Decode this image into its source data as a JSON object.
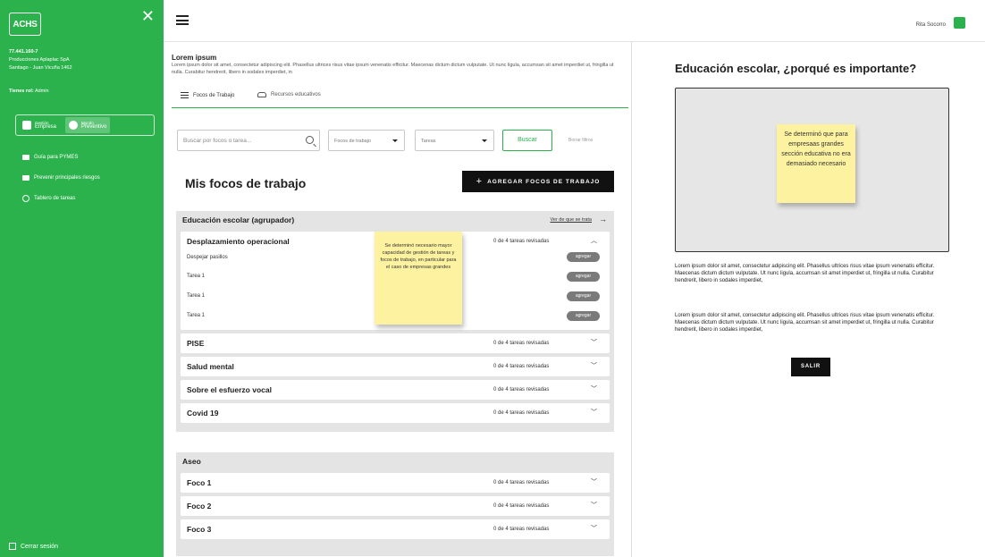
{
  "sidebar": {
    "logo": "ACHS",
    "company_lines": [
      "77.441.160-7",
      "Producciones Aplaplac SpA",
      "Santiago - Juan Vicuña 1462"
    ],
    "role_label": "Tienes rol:",
    "role_value": "Admin",
    "switch": [
      {
        "small": "Gestión",
        "label": "Empresa"
      },
      {
        "small": "Mundo",
        "label": "Preventivo"
      }
    ],
    "nav": [
      "Guía para PYMES",
      "Prevenir principales riesgos",
      "Tablero de tareas"
    ],
    "logout": "Cerrar sesión"
  },
  "header": {
    "user_name": "Rita Socorro"
  },
  "main": {
    "intro_title": "Lorem ipsum",
    "intro_text": "Lorem ipsum dolor sit amet, consectetur adipiscing elit. Phasellus ultrices risus vitae ipsum venenatis efficitur. Maecenas dictum dictum vulputate. Ut nunc ligula, accumsan sit amet imperdiet ut, fringilla ut nulla. Curabitur hendrerit, libero in sodales imperdiet, in",
    "tabs": [
      "Focos de Trabajo",
      "Recursos educativos"
    ],
    "search_placeholder": "Buscar por focos o tarea...",
    "select_focos": "Focos de trabajo",
    "select_tareas": "Tareas",
    "buscar": "Buscar",
    "borrar": "Borrar filtros",
    "section_title": "Mis focos de trabajo",
    "add_button": "AGREGAR FOCOS DE TRABAJO",
    "group1": {
      "name": "Educación escolar (agrupador)",
      "link": "Ver de que se trata",
      "expanded": {
        "title": "Desplazamiento operacional",
        "status": "0 de 4 tareas revisadas",
        "tasks": [
          "Despejar pasillos",
          "Tarea 1",
          "Tarea 1",
          "Tarea 1"
        ],
        "task_button": "agregar"
      },
      "items": [
        {
          "title": "PISE",
          "status": "0 de 4 tareas revisadas"
        },
        {
          "title": "Salud mental",
          "status": "0 de 4 tareas revisadas"
        },
        {
          "title": "Sobre el esfuerzo vocal",
          "status": "0 de 4 tareas revisadas"
        },
        {
          "title": "Covid 19",
          "status": "0 de 4 tareas revisadas"
        }
      ]
    },
    "group2": {
      "name": "Aseo",
      "items": [
        {
          "title": "Foco 1",
          "status": "0 de 4 tareas revisadas"
        },
        {
          "title": "Foco 2",
          "status": "0 de 4 tareas revisadas"
        },
        {
          "title": "Foco 3",
          "status": "0 de 4 tareas revisadas"
        }
      ]
    },
    "sticky_note": "Se determinó necesario mayor capacidad de gestión de tareas y focos de trabajo, en particular para el caso de empresas grandes"
  },
  "right_panel": {
    "title": "Educación escolar, ¿porqué es importante?",
    "sticky_note": "Se determinó que para empresaas grandes sección educativa no era demasiado necesario",
    "paragraph1": "Lorem ipsum dolor sit amet, consectetur adipiscing elit. Phasellus ultrices risus vitae ipsum venenatis efficitur. Maecenas dictum dictum vulputate. Ut nunc ligula, accumsan sit amet imperdiet ut, fringilla ut nulla. Curabitur hendrerit, libero in sodales imperdiet,",
    "paragraph2": "Lorem ipsum dolor sit amet, consectetur adipiscing elit. Phasellus ultrices risus vitae ipsum venenatis efficitur. Maecenas dictum dictum vulputate. Ut nunc ligula, accumsan sit amet imperdiet ut, fringilla ut nulla. Curabitur hendrerit, libero in sodales imperdiet,",
    "exit_button": "SALIR"
  },
  "colors": {
    "brand_green": "#2bb24c",
    "sticky_yellow": "#fdf2a0",
    "dark": "#111111"
  }
}
